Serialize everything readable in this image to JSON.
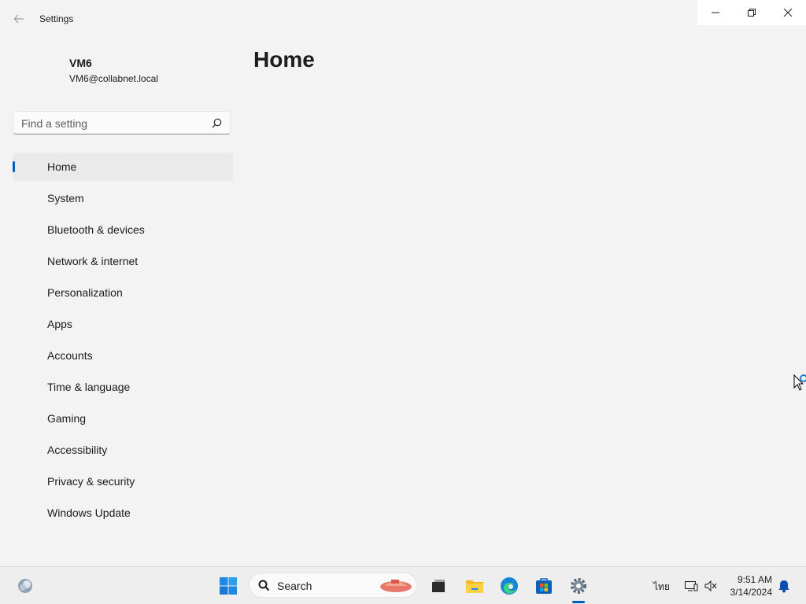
{
  "window": {
    "title": "Settings",
    "page_title": "Home"
  },
  "user": {
    "name": "VM6",
    "email": "VM6@collabnet.local"
  },
  "search": {
    "placeholder": "Find a setting",
    "value": ""
  },
  "nav": {
    "items": [
      {
        "label": "Home",
        "selected": true
      },
      {
        "label": "System"
      },
      {
        "label": "Bluetooth & devices"
      },
      {
        "label": "Network & internet"
      },
      {
        "label": "Personalization"
      },
      {
        "label": "Apps"
      },
      {
        "label": "Accounts"
      },
      {
        "label": "Time & language"
      },
      {
        "label": "Gaming"
      },
      {
        "label": "Accessibility"
      },
      {
        "label": "Privacy & security"
      },
      {
        "label": "Windows Update"
      }
    ]
  },
  "taskbar": {
    "search_label": "Search",
    "apps": [
      "widgets-icon",
      "start-icon",
      "task-view-icon",
      "file-explorer-icon",
      "edge-icon",
      "store-icon",
      "settings-icon"
    ],
    "language": "ไทย",
    "time": "9:51 AM",
    "date": "3/14/2024"
  },
  "colors": {
    "accent": "#005fb8",
    "background": "#f3f3f3"
  }
}
